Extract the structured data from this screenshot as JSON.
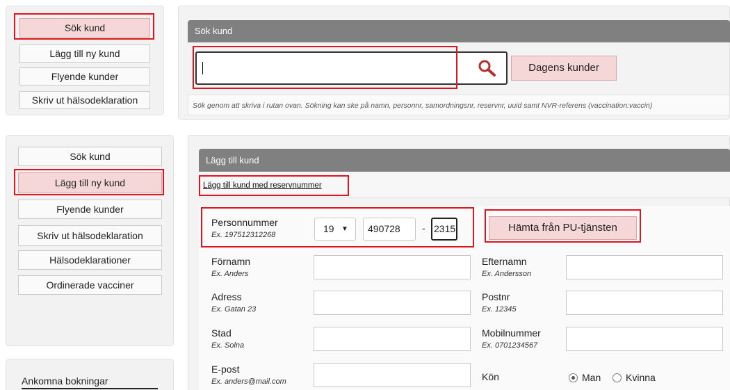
{
  "top": {
    "sidebar": [
      "Sök kund",
      "Lägg till ny kund",
      "Flyende kunder",
      "Skriv ut hälsodeklaration"
    ],
    "panel_title": "Sök kund",
    "search_value": "",
    "today_button": "Dagens kunder",
    "hint": "Sök genom att skriva i rutan ovan. Sökning kan ske på namn, personnr, samordningsnr, reservnr, uuid samt NVR-referens (vaccination:vaccin)"
  },
  "bottom": {
    "sidebar": [
      "Sök kund",
      "Lägg till ny kund",
      "Flyende kunder",
      "Skriv ut hälsodeklaration",
      "Hälsodeklarationer",
      "Ordinerade vacciner"
    ],
    "second_sidebar_label": "Ankomna bokningar",
    "panel_title": "Lägg till kund",
    "reserve_link": "Lägg till kund med reservnummer",
    "personnummer": {
      "label": "Personnummer",
      "example": "Ex. 197512312268",
      "century": "19",
      "date": "490728",
      "dash": "-",
      "suffix": "2315",
      "fetch_button": "Hämta från PU-tjänsten"
    },
    "fields": {
      "fornamn": {
        "label": "Förnamn",
        "example": "Ex. Anders"
      },
      "efternamn": {
        "label": "Efternamn",
        "example": "Ex. Andersson"
      },
      "adress": {
        "label": "Adress",
        "example": "Ex. Gatan 23"
      },
      "postnr": {
        "label": "Postnr",
        "example": "Ex. 12345"
      },
      "stad": {
        "label": "Stad",
        "example": "Ex. Solna"
      },
      "mobil": {
        "label": "Mobilnummer",
        "example": "Ex. 0701234567"
      },
      "epost": {
        "label": "E-post",
        "example": "Ex. anders@mail.com"
      }
    },
    "kon": {
      "label": "Kön",
      "options": [
        "Man",
        "Kvinna"
      ],
      "selected": "Man"
    }
  },
  "colors": {
    "highlight_red": "#e0141e",
    "button_pink": "#f6d7d7",
    "header_gray": "#808080"
  }
}
